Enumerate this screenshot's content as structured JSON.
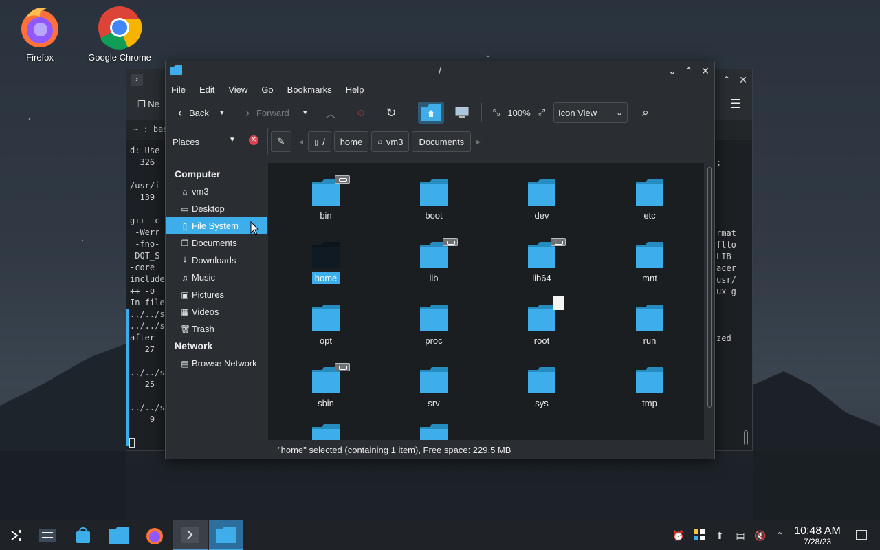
{
  "desktop": {
    "icons": [
      {
        "label": "Firefox"
      },
      {
        "label": "Google Chrome"
      }
    ]
  },
  "konsole": {
    "tab_label": "~ : bash",
    "toolbar_partial": "Ne",
    "left_lines": "d: Use\n  326\n\n/usr/i\n  139\n\ng++ -c\n -Werr\n -fno-\n-DQT_S\n-core \ninclude\n++ -o \nIn file\n../../s\n../../s\nafter \n   27\n\n../../s\n   25\n\n../../s\n    9",
    "right_lines": ";\n\n\n\n\n\nrmat\nflto\nLIB\nacer\nusr/\nux-g\n\n\n\nzed"
  },
  "dolphin": {
    "title": "/",
    "menu": [
      "File",
      "Edit",
      "View",
      "Go",
      "Bookmarks",
      "Help"
    ],
    "toolbar": {
      "back": "Back",
      "forward": "Forward",
      "zoom": "100%",
      "view_mode": "Icon View"
    },
    "places_label": "Places",
    "breadcrumbs": [
      "/",
      "home",
      "vm3",
      "Documents"
    ],
    "sidebar": {
      "computer_heading": "Computer",
      "computer_items": [
        {
          "label": "vm3",
          "icon": "home-icon"
        },
        {
          "label": "Desktop",
          "icon": "desktop-icon"
        },
        {
          "label": "File System",
          "icon": "drive-icon",
          "active": true
        },
        {
          "label": "Documents",
          "icon": "documents-icon"
        },
        {
          "label": "Downloads",
          "icon": "download-icon"
        },
        {
          "label": "Music",
          "icon": "music-icon"
        },
        {
          "label": "Pictures",
          "icon": "pictures-icon"
        },
        {
          "label": "Videos",
          "icon": "videos-icon"
        },
        {
          "label": "Trash",
          "icon": "trash-icon"
        }
      ],
      "network_heading": "Network",
      "network_items": [
        {
          "label": "Browse Network",
          "icon": "network-icon"
        }
      ]
    },
    "folders": [
      {
        "name": "bin",
        "badge": "link"
      },
      {
        "name": "boot"
      },
      {
        "name": "dev"
      },
      {
        "name": "etc"
      },
      {
        "name": "home",
        "selected": true
      },
      {
        "name": "lib",
        "badge": "link"
      },
      {
        "name": "lib64",
        "badge": "link"
      },
      {
        "name": "mnt"
      },
      {
        "name": "opt"
      },
      {
        "name": "proc"
      },
      {
        "name": "root",
        "badge": "doc"
      },
      {
        "name": "run"
      },
      {
        "name": "sbin",
        "badge": "link"
      },
      {
        "name": "srv"
      },
      {
        "name": "sys"
      },
      {
        "name": "tmp"
      },
      {
        "name": ""
      },
      {
        "name": ""
      }
    ],
    "status": "\"home\" selected (containing 1 item), Free space: 229.5 MB"
  },
  "taskbar": {
    "time": "10:48 AM",
    "date": "7/28/23"
  },
  "colors": {
    "accent": "#3daee9",
    "folder": "#3daee9",
    "folder_dark": "#268bbf"
  }
}
